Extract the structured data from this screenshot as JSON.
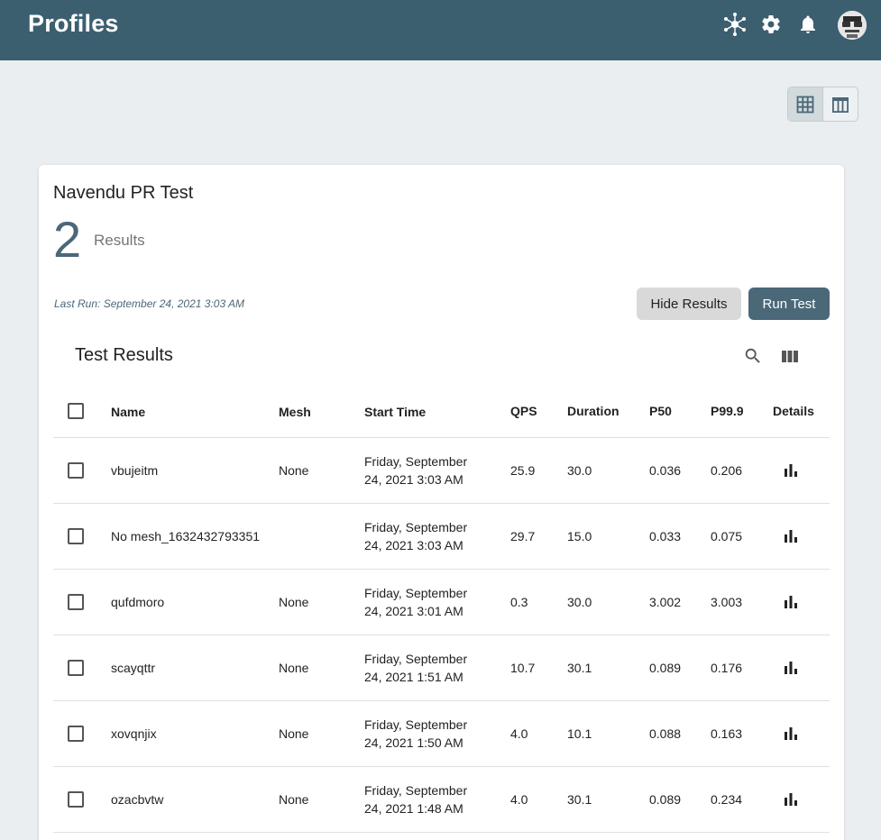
{
  "header": {
    "title": "Profiles",
    "icons": [
      "mesh-network-icon",
      "gear-icon",
      "bell-icon",
      "avatar"
    ]
  },
  "view_toggle": {
    "options": [
      "grid-view-icon",
      "table-view-icon"
    ],
    "active": "grid-view-icon"
  },
  "profile": {
    "name": "Navendu PR Test",
    "result_count": "2",
    "result_label": "Results",
    "last_run": "Last Run: September 24, 2021 3:03 AM",
    "hide_button": "Hide Results",
    "run_button": "Run Test"
  },
  "results_table": {
    "title": "Test Results",
    "toolbar_icons": [
      "search-icon",
      "view-columns-icon"
    ],
    "columns": {
      "name": "Name",
      "mesh": "Mesh",
      "start_time": "Start Time",
      "qps": "QPS",
      "duration": "Duration",
      "p50": "P50",
      "p999": "P99.9",
      "details": "Details"
    },
    "rows": [
      {
        "name": "vbujeitm",
        "mesh": "None",
        "start_line1": "Friday, September",
        "start_line2": "24, 2021 3:03 AM",
        "qps": "25.9",
        "duration": "30.0",
        "p50": "0.036",
        "p999": "0.206"
      },
      {
        "name": "No mesh_1632432793351",
        "mesh": "",
        "start_line1": "Friday, September",
        "start_line2": "24, 2021 3:03 AM",
        "qps": "29.7",
        "duration": "15.0",
        "p50": "0.033",
        "p999": "0.075"
      },
      {
        "name": "qufdmoro",
        "mesh": "None",
        "start_line1": "Friday, September",
        "start_line2": "24, 2021 3:01 AM",
        "qps": "0.3",
        "duration": "30.0",
        "p50": "3.002",
        "p999": "3.003"
      },
      {
        "name": "scayqttr",
        "mesh": "None",
        "start_line1": "Friday, September",
        "start_line2": "24, 2021 1:51 AM",
        "qps": "10.7",
        "duration": "30.1",
        "p50": "0.089",
        "p999": "0.176"
      },
      {
        "name": "xovqnjix",
        "mesh": "None",
        "start_line1": "Friday, September",
        "start_line2": "24, 2021 1:50 AM",
        "qps": "4.0",
        "duration": "10.1",
        "p50": "0.088",
        "p999": "0.163"
      },
      {
        "name": "ozacbvtw",
        "mesh": "None",
        "start_line1": "Friday, September",
        "start_line2": "24, 2021 1:48 AM",
        "qps": "4.0",
        "duration": "30.1",
        "p50": "0.089",
        "p999": "0.234"
      }
    ]
  },
  "colors": {
    "topbar": "#3c5f70",
    "accent": "#4a6878",
    "background": "#eaeef1"
  }
}
